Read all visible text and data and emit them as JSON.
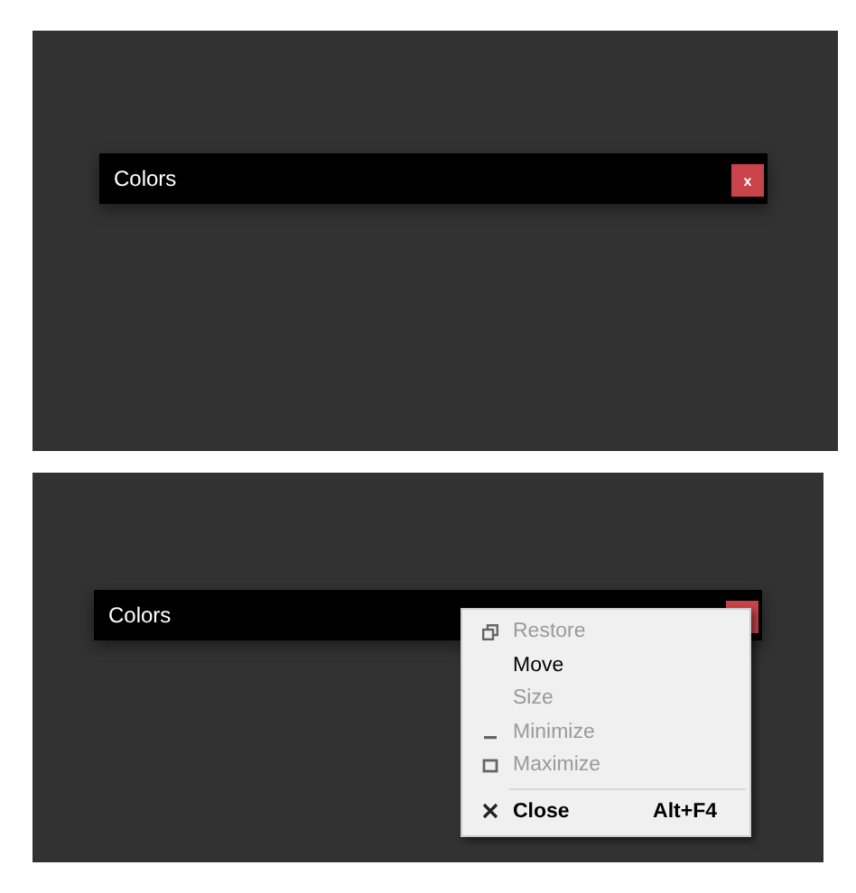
{
  "panels": [
    {
      "title": "Colors",
      "close_button": {
        "label": "x"
      }
    },
    {
      "title": "Colors",
      "menu": {
        "items": [
          {
            "kind": "restore",
            "label": "Restore",
            "disabled": true,
            "default": false
          },
          {
            "kind": "plain",
            "label": "Move",
            "disabled": false,
            "default": false
          },
          {
            "kind": "plain",
            "label": "Size",
            "disabled": true,
            "default": false
          },
          {
            "kind": "minimize",
            "label": "Minimize",
            "disabled": true,
            "default": false
          },
          {
            "kind": "maximize",
            "label": "Maximize",
            "disabled": true,
            "default": false
          },
          {
            "kind": "separator"
          },
          {
            "kind": "close",
            "label": "Close",
            "disabled": false,
            "default": true,
            "shortcut": "Alt+F4"
          }
        ]
      }
    }
  ]
}
